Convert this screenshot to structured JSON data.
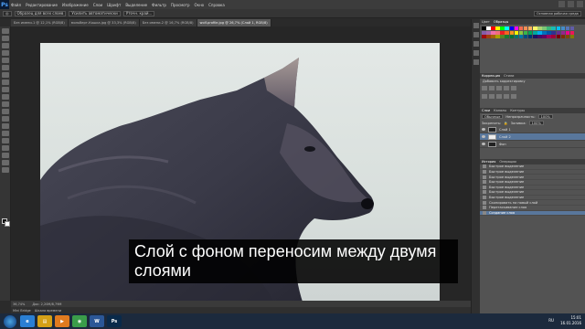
{
  "app": {
    "logo": "Ps"
  },
  "menu": [
    "Файл",
    "Редактирование",
    "Изображение",
    "Слои",
    "Шрифт",
    "Выделение",
    "Фильтр",
    "Просмотр",
    "Окно",
    "Справка"
  ],
  "options": {
    "chips": [
      "Образец для всех слоев",
      "Усилить автоматически",
      "Уточн. край..."
    ],
    "workspace": "Основная рабочая среда"
  },
  "doc_tabs": [
    {
      "label": "Без имени-1 @ 12,1% (RGB/8)",
      "active": false
    },
    {
      "label": "мольберт-Кошка.jpg @ 33,3% (RGB/8)",
      "active": false
    },
    {
      "label": "Без имени-2 @ 16,7% (RGB/8)",
      "active": false
    },
    {
      "label": "wolf-profile.jpg @ 26,7% (Слой 1, RGB/8)",
      "active": true
    }
  ],
  "status": {
    "zoom": "36,74%",
    "doc": "Док: 2,20М/8,79М"
  },
  "mini_bridge": [
    "Mini Bridge",
    "Шкала времени"
  ],
  "panels": {
    "color_tabs": [
      "Цвет",
      "Образцы"
    ],
    "adjust_tabs": [
      "Коррекция",
      "Стили"
    ],
    "adjust_title": "Добавить корректировку",
    "layers_tabs": [
      "Слои",
      "Каналы",
      "Контуры"
    ],
    "blend_mode": "Обычные",
    "opacity_label": "Непрозрачность:",
    "opacity_value": "100%",
    "lock_label": "Закрепить:",
    "fill_label": "Заливка:",
    "fill_value": "100%",
    "layers": [
      {
        "name": "Слой 1",
        "selected": false,
        "thumb": "dark"
      },
      {
        "name": "Слой 2",
        "selected": true,
        "thumb": "white"
      },
      {
        "name": "Фон",
        "selected": false,
        "thumb": "dark"
      }
    ],
    "history_tabs": [
      "История",
      "Операции"
    ],
    "history": [
      {
        "label": "Быстрое выделение",
        "selected": false
      },
      {
        "label": "Быстрое выделение",
        "selected": false
      },
      {
        "label": "Быстрое выделение",
        "selected": false
      },
      {
        "label": "Быстрое выделение",
        "selected": false
      },
      {
        "label": "Быстрое выделение",
        "selected": false
      },
      {
        "label": "Быстрое выделение",
        "selected": false
      },
      {
        "label": "Быстрое выделение",
        "selected": false
      },
      {
        "label": "Скопировать на новый слой",
        "selected": false
      },
      {
        "label": "Перетаскивание слоя",
        "selected": false
      },
      {
        "label": "Создание слоя",
        "selected": true
      }
    ],
    "swatch_colors": [
      "#000000",
      "#ffffff",
      "#ff0000",
      "#ffff00",
      "#00ff00",
      "#00ffff",
      "#0000ff",
      "#ff00ff",
      "#f26c4f",
      "#f68e55",
      "#fbaf5d",
      "#fff568",
      "#acd372",
      "#7cc576",
      "#3bb878",
      "#1abbb4",
      "#00bff3",
      "#438ccb",
      "#5574b9",
      "#605ca8",
      "#855fa8",
      "#a763a8",
      "#f06ea9",
      "#f26d7d",
      "#ed1c24",
      "#f26522",
      "#f7941d",
      "#fff200",
      "#8dc63f",
      "#39b54a",
      "#00a651",
      "#00a99d",
      "#00aeef",
      "#0072bc",
      "#0054a6",
      "#2e3192",
      "#662d91",
      "#92278f",
      "#ec008c",
      "#ed145b",
      "#9e0b0f",
      "#a0410d",
      "#a36209",
      "#aba000",
      "#598527",
      "#1a7b30",
      "#007236",
      "#00746b",
      "#0076a3",
      "#004b80",
      "#003471",
      "#1b1464",
      "#440e62",
      "#630460",
      "#9e005d",
      "#9e0039",
      "#790000",
      "#7b2e00",
      "#7d4900",
      "#827b00"
    ]
  },
  "taskbar": {
    "apps": [
      {
        "name": "ie-icon",
        "color": "#2a7fd4",
        "glyph": "e"
      },
      {
        "name": "folder-icon",
        "color": "#d4a017",
        "glyph": "▤"
      },
      {
        "name": "media-icon",
        "color": "#e07b1f",
        "glyph": "▶"
      },
      {
        "name": "chrome-icon",
        "color": "#3a9d4a",
        "glyph": "◉"
      },
      {
        "name": "word-icon",
        "color": "#2b5797",
        "glyph": "W"
      },
      {
        "name": "photoshop-icon",
        "color": "#0a2a4a",
        "glyph": "Ps"
      }
    ],
    "time": "15:01",
    "date": "16.01.2016",
    "lang": "RU"
  },
  "subtitle": "Слой с фоном переносим между двумя слоями"
}
